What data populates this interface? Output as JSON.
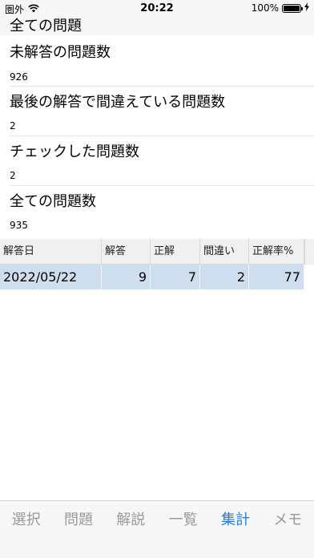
{
  "status_bar": {
    "carrier": "圏外",
    "time": "20:22",
    "battery": "100%",
    "wifi_icon": "wifi-icon",
    "battery_level": 1.0
  },
  "header": {
    "title": "全ての問題"
  },
  "stats": [
    {
      "label": "未解答の問題数",
      "value": "926"
    },
    {
      "label": "最後の解答で間違えている問題数",
      "value": "2"
    },
    {
      "label": "チェックした問題数",
      "value": "2"
    },
    {
      "label": "全ての問題数",
      "value": "935"
    }
  ],
  "table": {
    "columns": [
      "解答日",
      "解答",
      "正解",
      "間違い",
      "正解率%"
    ],
    "rows": [
      [
        "2022/05/22",
        "9",
        "7",
        "2",
        "77"
      ]
    ],
    "row_highlight_color": "#cfdeef"
  },
  "tabs": [
    {
      "label": "選択"
    },
    {
      "label": "問題"
    },
    {
      "label": "解説"
    },
    {
      "label": "一覧"
    },
    {
      "label": "集計"
    },
    {
      "label": "メモ"
    }
  ],
  "active_tab_color": "#1a7ff0"
}
